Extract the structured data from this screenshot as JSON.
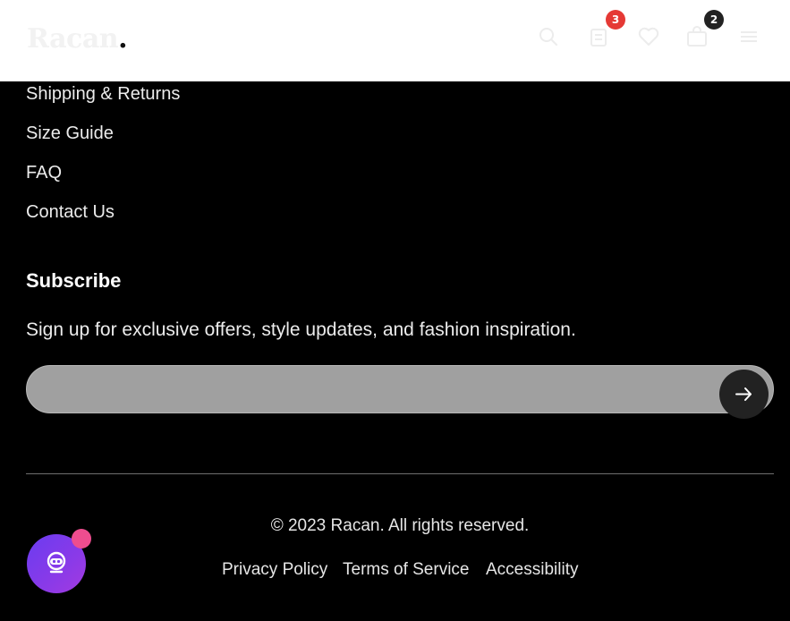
{
  "header": {
    "logo_text": "Racan",
    "logo_dot": ".",
    "icons": [
      "search-icon",
      "compare-icon",
      "heart-icon",
      "cart-icon",
      "menu-icon"
    ],
    "compare_count": "3",
    "cart_count": "2",
    "colors": {
      "compare_badge": "#e53935",
      "cart_badge": "#222222"
    }
  },
  "footer": {
    "links": [
      "Shipping & Returns",
      "Size Guide",
      "FAQ",
      "Contact Us"
    ],
    "subscribe": {
      "title": "Subscribe",
      "description": "Sign up for exclusive offers, style updates, and fashion inspiration.",
      "email_placeholder": "",
      "submit_icon": "arrow-right-icon"
    },
    "copyright": "© 2023 Racan. All rights reserved.",
    "legal_links": [
      "Privacy Policy",
      "Terms of Service",
      "Accessibility"
    ]
  },
  "chat_widget": {
    "icon": "chat-bot-icon",
    "accent": "#7b3bea",
    "dot_color": "#ee4d8f"
  }
}
